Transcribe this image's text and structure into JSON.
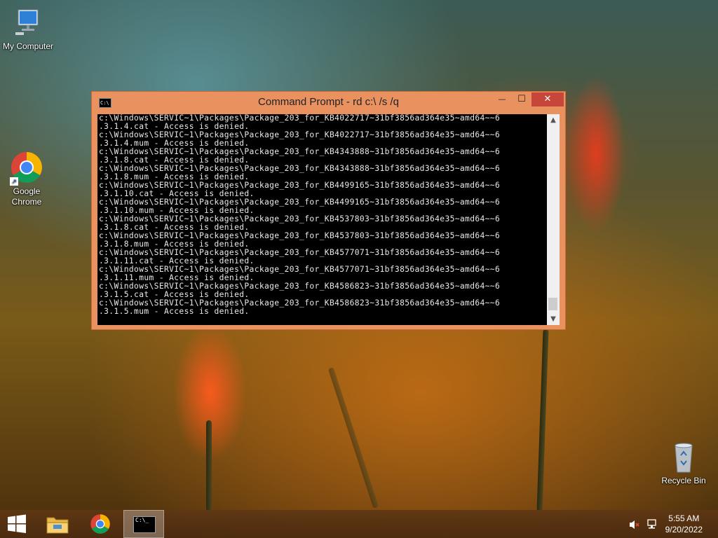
{
  "desktop": {
    "icons": {
      "my_computer": "My Computer",
      "chrome": "Google Chrome",
      "recycle_bin": "Recycle Bin"
    }
  },
  "window": {
    "title": "Command Prompt - rd  c:\\ /s /q",
    "minimize": "—",
    "maximize": "☐",
    "close": "✕",
    "console_lines": [
      "c:\\Windows\\SERVIC~1\\Packages\\Package_203_for_KB4022717~31bf3856ad364e35~amd64~~6",
      ".3.1.4.cat - Access is denied.",
      "c:\\Windows\\SERVIC~1\\Packages\\Package_203_for_KB4022717~31bf3856ad364e35~amd64~~6",
      ".3.1.4.mum - Access is denied.",
      "c:\\Windows\\SERVIC~1\\Packages\\Package_203_for_KB4343888~31bf3856ad364e35~amd64~~6",
      ".3.1.8.cat - Access is denied.",
      "c:\\Windows\\SERVIC~1\\Packages\\Package_203_for_KB4343888~31bf3856ad364e35~amd64~~6",
      ".3.1.8.mum - Access is denied.",
      "c:\\Windows\\SERVIC~1\\Packages\\Package_203_for_KB4499165~31bf3856ad364e35~amd64~~6",
      ".3.1.10.cat - Access is denied.",
      "c:\\Windows\\SERVIC~1\\Packages\\Package_203_for_KB4499165~31bf3856ad364e35~amd64~~6",
      ".3.1.10.mum - Access is denied.",
      "c:\\Windows\\SERVIC~1\\Packages\\Package_203_for_KB4537803~31bf3856ad364e35~amd64~~6",
      ".3.1.8.cat - Access is denied.",
      "c:\\Windows\\SERVIC~1\\Packages\\Package_203_for_KB4537803~31bf3856ad364e35~amd64~~6",
      ".3.1.8.mum - Access is denied.",
      "c:\\Windows\\SERVIC~1\\Packages\\Package_203_for_KB4577071~31bf3856ad364e35~amd64~~6",
      ".3.1.11.cat - Access is denied.",
      "c:\\Windows\\SERVIC~1\\Packages\\Package_203_for_KB4577071~31bf3856ad364e35~amd64~~6",
      ".3.1.11.mum - Access is denied.",
      "c:\\Windows\\SERVIC~1\\Packages\\Package_203_for_KB4586823~31bf3856ad364e35~amd64~~6",
      ".3.1.5.cat - Access is denied.",
      "c:\\Windows\\SERVIC~1\\Packages\\Package_203_for_KB4586823~31bf3856ad364e35~amd64~~6",
      ".3.1.5.mum - Access is denied."
    ],
    "scroll_position": 0.95
  },
  "taskbar": {
    "items": [
      "start-icon",
      "file-explorer-icon",
      "chrome-icon",
      "command-prompt-icon"
    ],
    "tray_icons": [
      "speaker-muted-icon",
      "network-icon"
    ],
    "clock": {
      "time": "5:55 AM",
      "date": "9/20/2022"
    }
  },
  "colors": {
    "window_frame": "#ea9160",
    "close_button": "#c7463a",
    "console_bg": "#000000",
    "console_text": "#e8e8e8"
  }
}
